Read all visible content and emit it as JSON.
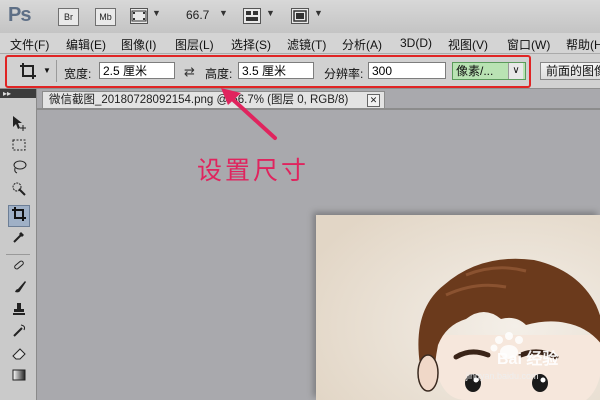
{
  "app": {
    "logo": "Ps",
    "bridge_label": "Br",
    "minibridge_label": "Mb",
    "zoom_value": "66.7"
  },
  "menu": [
    {
      "label": "文件(F)"
    },
    {
      "label": "编辑(E)"
    },
    {
      "label": "图像(I)"
    },
    {
      "label": "图层(L)"
    },
    {
      "label": "选择(S)"
    },
    {
      "label": "滤镜(T)"
    },
    {
      "label": "分析(A)"
    },
    {
      "label": "3D(D)"
    },
    {
      "label": "视图(V)"
    },
    {
      "label": "窗口(W)"
    },
    {
      "label": "帮助(H)"
    }
  ],
  "options": {
    "width_label": "宽度:",
    "width_value": "2.5 厘米",
    "swap_icon": "⇄",
    "height_label": "高度:",
    "height_value": "3.5 厘米",
    "resolution_label": "分辨率:",
    "resolution_value": "300",
    "unit_value": "像素/...",
    "front_image_button": "前面的图像"
  },
  "document": {
    "tab_title": "微信截图_20180728092154.png @ 66.7% (图层 0, RGB/8)",
    "close_glyph": "✕"
  },
  "annotation": {
    "text": "设置尺寸",
    "color": "#e0245e",
    "box_color": "#e02424"
  },
  "watermark": {
    "text": "Bai 经验",
    "sub": "jingyan.baidu.com"
  },
  "colors": {
    "unit_select_bg": "#b9e3b3",
    "active_tool_bg": "#9fb0c6"
  }
}
